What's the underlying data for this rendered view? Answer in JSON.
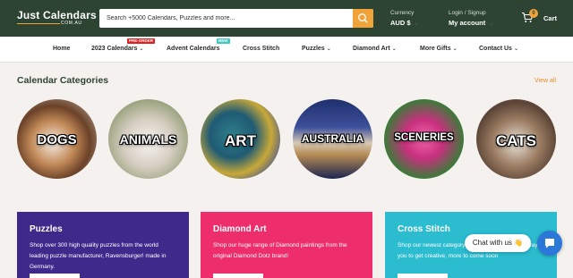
{
  "header": {
    "logo_line1": "Just Calendars",
    "logo_line2": "COM.AU",
    "search_placeholder": "Search +5000 Calendars, Puzzles and more...",
    "currency_label": "Currency",
    "currency_value": "AUD $",
    "login_label": "Login / Signup",
    "account_label": "My account",
    "cart_label": "Cart",
    "cart_count": "0"
  },
  "nav": {
    "items": [
      {
        "label": "Home"
      },
      {
        "label": "2023 Calendars",
        "tag": "PRE-ORDER"
      },
      {
        "label": "Advent Calendars",
        "tag": "NEW"
      },
      {
        "label": "Cross Stitch"
      },
      {
        "label": "Puzzles"
      },
      {
        "label": "Diamond Art"
      },
      {
        "label": "More Gifts"
      },
      {
        "label": "Contact Us"
      }
    ]
  },
  "categories": {
    "title": "Calendar Categories",
    "view_all": "View all",
    "items": [
      {
        "label": "DOGS"
      },
      {
        "label": "ANIMALS"
      },
      {
        "label": "ART"
      },
      {
        "label": "AUSTRALIA"
      },
      {
        "label": "SCENERIES"
      },
      {
        "label": "CATS"
      }
    ]
  },
  "cards": [
    {
      "title": "Puzzles",
      "body": "Shop over 300 high quality puzzles from the world leading puzzle manufacturer, Ravensburger! made in Germany.",
      "color": "#3f2a8c"
    },
    {
      "title": "Diamond Art",
      "body": "Shop our huge range of Diamond paintings from the original Diamond Dotz brand!",
      "color": "#ee2d6c"
    },
    {
      "title": "Cross Stitch",
      "body": "Shop our newest category: Cross Stitch. A perfect way for you to get creative, more to come soon",
      "color": "#2bbcd0"
    }
  ],
  "chat": {
    "label": "Chat with us 👋"
  },
  "colors": {
    "header_bg": "#2e4433",
    "accent": "#f0a33a",
    "chat_button": "#2c78d8"
  }
}
